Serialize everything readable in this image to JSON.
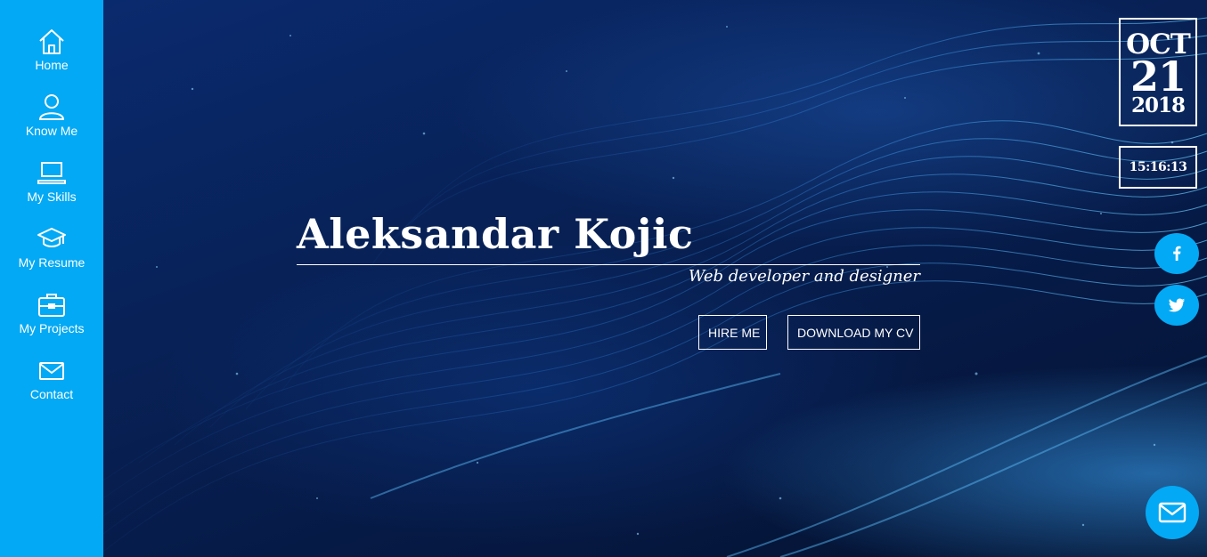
{
  "sidebar": {
    "background_color": "#03a9f4",
    "items": [
      {
        "label": "Home",
        "icon": "home-icon"
      },
      {
        "label": "Know Me",
        "icon": "user-icon"
      },
      {
        "label": "My Skills",
        "icon": "laptop-icon"
      },
      {
        "label": "My Resume",
        "icon": "graduation-cap-icon"
      },
      {
        "label": "My Projects",
        "icon": "briefcase-icon"
      },
      {
        "label": "Contact",
        "icon": "envelope-icon"
      }
    ]
  },
  "hero": {
    "name": "Aleksandar Kojic",
    "subtitle": "Web developer and designer",
    "buttons": {
      "hire": "HIRE ME",
      "download_cv": "DOWNLOAD MY CV"
    }
  },
  "date_widget": {
    "month": "OCT",
    "day": "21",
    "year": "2018",
    "time": "15:16:13"
  },
  "social": {
    "facebook_icon": "facebook-icon",
    "twitter_icon": "twitter-icon",
    "mail_icon": "mail-icon"
  },
  "colors": {
    "accent": "#03a9f4",
    "background_dark": "#061a44",
    "text": "#ffffff"
  }
}
